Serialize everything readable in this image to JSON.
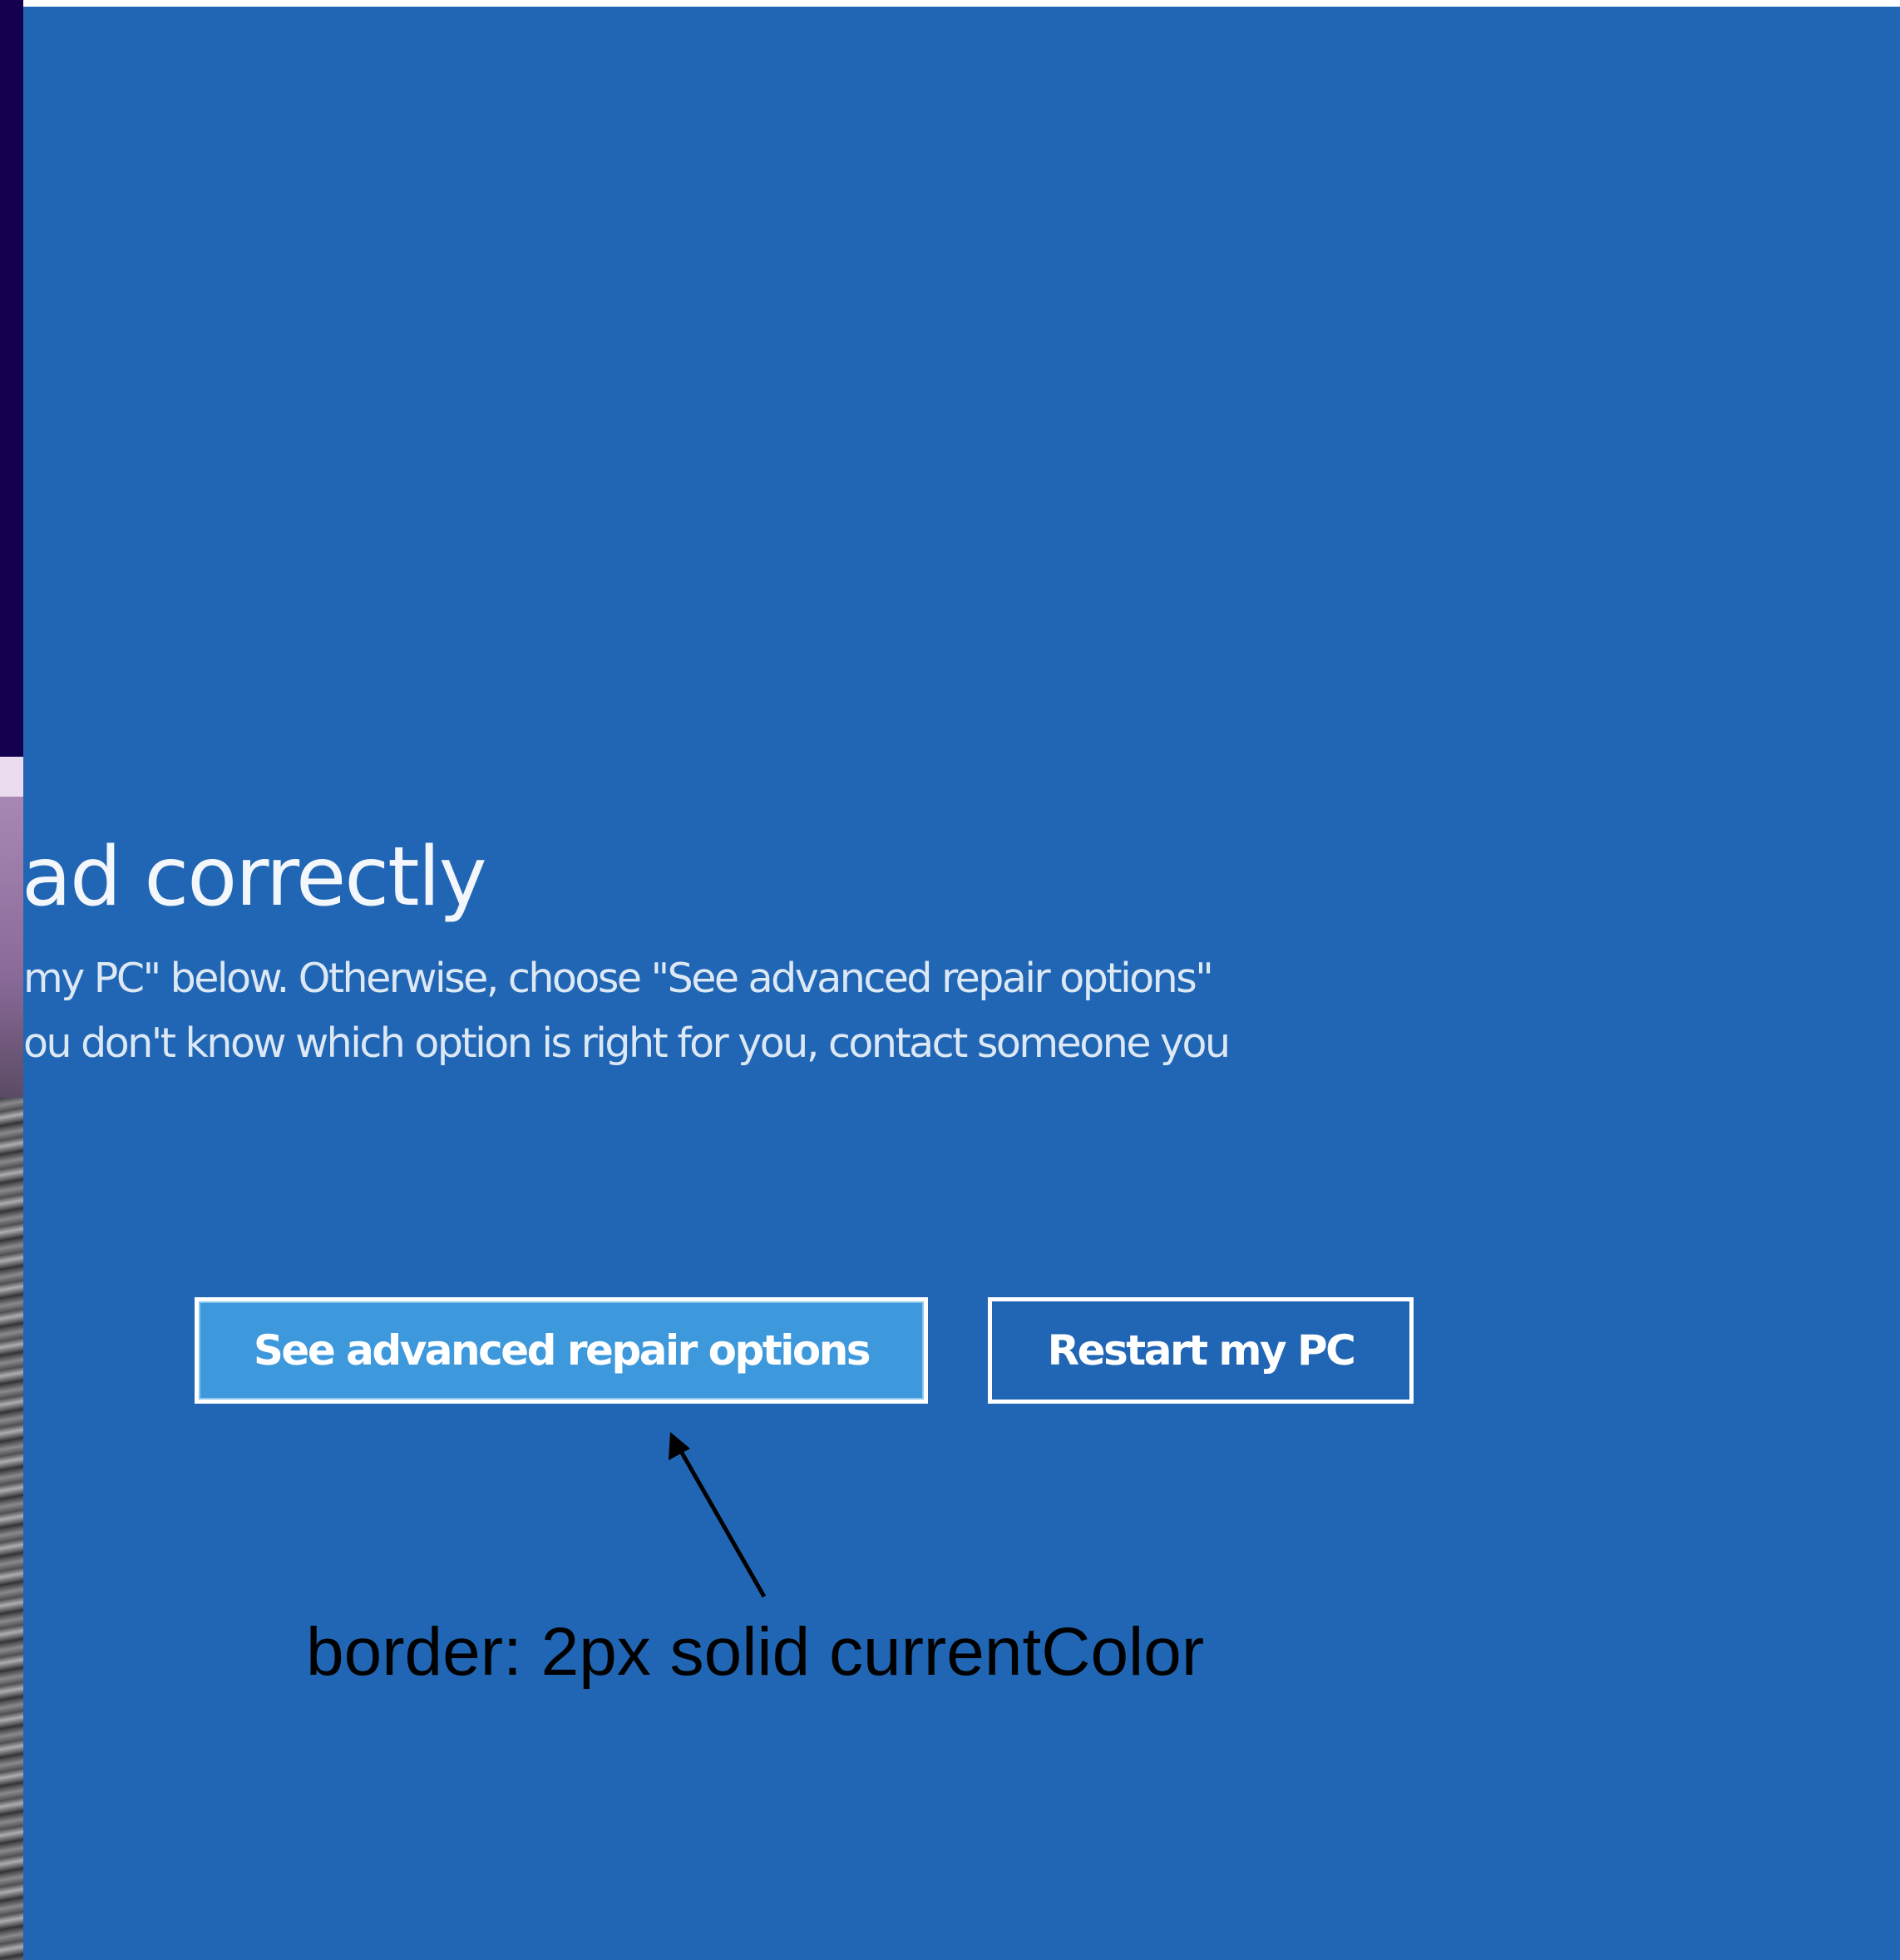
{
  "recovery": {
    "title": "ad correctly",
    "message_lines": [
      " my PC\" below. Otherwise, choose \"See advanced repair options\"",
      "ou don't know which option is right for you, contact someone you"
    ],
    "buttons": {
      "advanced": "See advanced repair options",
      "restart": "Restart my PC"
    }
  },
  "annotation": {
    "text": "border: 2px solid currentColor"
  },
  "colors": {
    "screen_background": "#2166b4",
    "focused_button": "#3d99dc",
    "text": "#ffffff",
    "annotation_text": "#000000"
  }
}
